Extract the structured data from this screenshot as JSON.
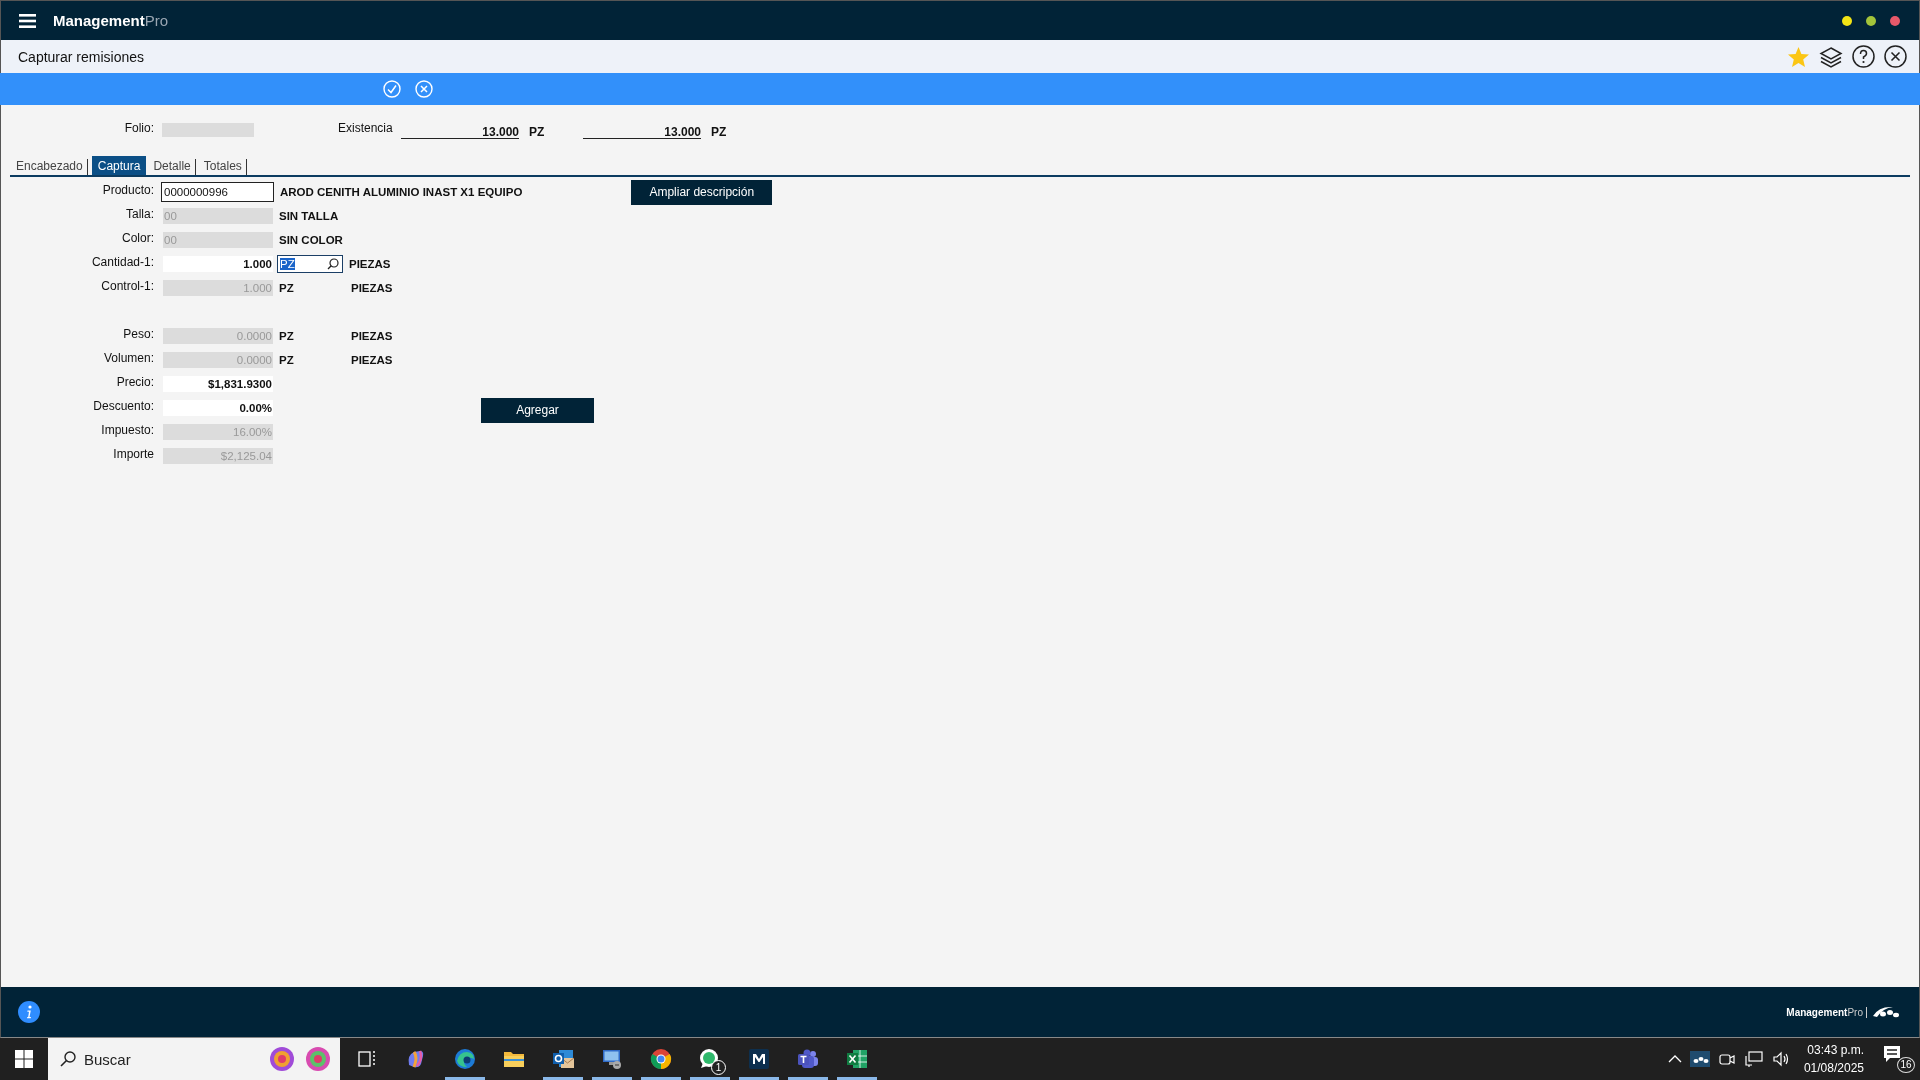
{
  "top_bar": {
    "brand": "Management",
    "brand_suffix": "Pro",
    "window_dots": [
      {
        "color": "#f2e415"
      },
      {
        "color": "#a3c43a"
      },
      {
        "color": "#e8596a"
      }
    ]
  },
  "title_bar": {
    "title": "Capturar remisiones"
  },
  "header": {
    "folio": {
      "label": "Folio:"
    },
    "existencia": {
      "label": "Existencia",
      "fields": [
        {
          "value": "13.000",
          "unit": "PZ"
        },
        {
          "value": "13.000",
          "unit": "PZ"
        }
      ]
    }
  },
  "tabs": [
    {
      "label": "Encabezado",
      "selected": false
    },
    {
      "label": "Captura",
      "selected": true
    },
    {
      "label": "Detalle",
      "selected": false
    },
    {
      "label": "Totales",
      "selected": false
    }
  ],
  "form": {
    "groups": [
      [
        {
          "label": "Producto:",
          "kind": "code",
          "value": "0000000996",
          "description": "AROD CENITH ALUMINIO INAST X1 EQUIPO",
          "button": "Ampliar descripción"
        },
        {
          "label": "Talla:",
          "kind": "readonly-code",
          "value": "00",
          "description": "SIN TALLA"
        },
        {
          "label": "Color:",
          "kind": "readonly-code",
          "value": "00",
          "description": "SIN COLOR"
        },
        {
          "label": "Cantidad-1:",
          "kind": "number",
          "value": "1.000",
          "unit_lookup": "PZ",
          "unit_name": "PIEZAS"
        },
        {
          "label": "Control-1:",
          "kind": "readonly",
          "value": "1.000",
          "unit": "PZ",
          "unit_name": "PIEZAS"
        }
      ],
      [
        {
          "label": "Peso:",
          "kind": "readonly",
          "value": "0.0000",
          "unit": "PZ",
          "unit_name": "PIEZAS"
        },
        {
          "label": "Volumen:",
          "kind": "readonly",
          "value": "0.0000",
          "unit": "PZ",
          "unit_name": "PIEZAS"
        },
        {
          "label": "Precio:",
          "kind": "number",
          "value": "$1,831.9300"
        },
        {
          "label": "Descuento:",
          "kind": "number",
          "value": "0.00%",
          "button": "Agregar"
        },
        {
          "label": "Impuesto:",
          "kind": "readonly",
          "value": "16.00%"
        },
        {
          "label": "Importe",
          "kind": "readonly",
          "value": "$2,125.04"
        }
      ]
    ]
  },
  "footer": {
    "brand": "Management",
    "brand_suffix": "Pro"
  },
  "taskbar": {
    "search": {
      "placeholder": "Buscar"
    },
    "apps": [
      {
        "kind": "task-view",
        "running": false
      },
      {
        "kind": "copilot",
        "running": false
      },
      {
        "kind": "edge",
        "running": true
      },
      {
        "kind": "folder",
        "running": false
      },
      {
        "kind": "outlook",
        "running": true
      },
      {
        "kind": "remote",
        "running": true
      },
      {
        "kind": "chrome",
        "running": true
      },
      {
        "kind": "chat",
        "running": true,
        "badge": "1"
      },
      {
        "kind": "m-app",
        "running": true
      },
      {
        "kind": "teams",
        "running": true
      },
      {
        "kind": "excel",
        "running": true
      }
    ],
    "clock": {
      "time": "03:43 p.m.",
      "date": "01/08/2025"
    },
    "notifications": "16"
  }
}
